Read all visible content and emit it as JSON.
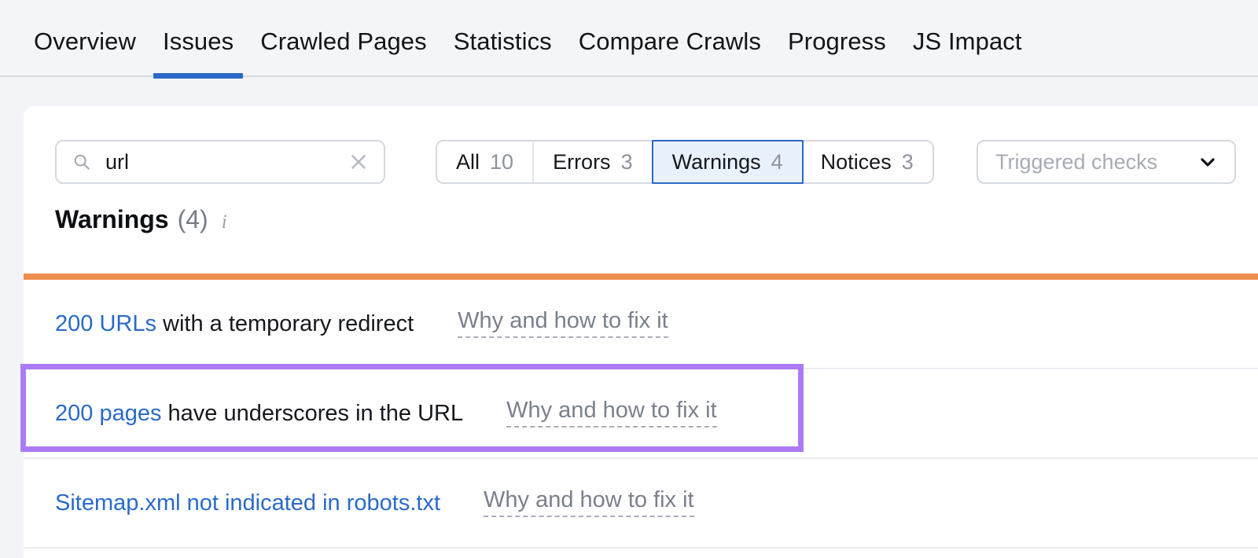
{
  "tabs": [
    {
      "label": "Overview",
      "active": false
    },
    {
      "label": "Issues",
      "active": true
    },
    {
      "label": "Crawled Pages",
      "active": false
    },
    {
      "label": "Statistics",
      "active": false
    },
    {
      "label": "Compare Crawls",
      "active": false
    },
    {
      "label": "Progress",
      "active": false
    },
    {
      "label": "JS Impact",
      "active": false
    }
  ],
  "toolbar": {
    "search": {
      "value": "url",
      "placeholder": "Search",
      "search_icon": "search-icon",
      "clear_icon": "close-icon"
    },
    "segments": [
      {
        "label": "All",
        "count": "10",
        "selected": false
      },
      {
        "label": "Errors",
        "count": "3",
        "selected": false
      },
      {
        "label": "Warnings",
        "count": "4",
        "selected": true
      },
      {
        "label": "Notices",
        "count": "3",
        "selected": false
      }
    ],
    "dropdown": {
      "label": "Triggered checks",
      "chevron_icon": "chevron-down-icon"
    }
  },
  "section": {
    "title": "Warnings",
    "count": "(4)",
    "info_icon": "i",
    "accent_color": "#ef8e4f"
  },
  "issues": [
    {
      "link_text": "200 URLs",
      "rest_text": " with a temporary redirect",
      "fix_label": "Why and how to fix it",
      "full_link": false
    },
    {
      "link_text": "200 pages",
      "rest_text": " have underscores in the URL",
      "fix_label": "Why and how to fix it",
      "full_link": false
    },
    {
      "link_text": "Sitemap.xml not indicated in robots.txt",
      "rest_text": "",
      "fix_label": "Why and how to fix it",
      "full_link": true
    }
  ],
  "annotation": {
    "color": "#ab7bf5",
    "target_row_index": "1"
  }
}
